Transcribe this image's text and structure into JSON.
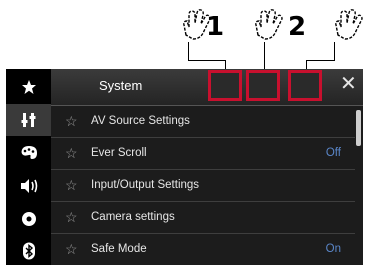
{
  "callouts": [
    {
      "number": "1"
    },
    {
      "number": "2"
    },
    {
      "number": ""
    }
  ],
  "header": {
    "title": "System"
  },
  "sidebar": {
    "items": [
      {
        "icon": "star-icon"
      },
      {
        "icon": "settings-icon"
      },
      {
        "icon": "theme-icon"
      },
      {
        "icon": "audio-icon"
      },
      {
        "icon": "disc-icon"
      },
      {
        "icon": "bluetooth-icon"
      }
    ]
  },
  "menu": {
    "items": [
      {
        "label": "AV Source Settings",
        "value": ""
      },
      {
        "label": "Ever Scroll",
        "value": "Off"
      },
      {
        "label": "Input/Output Settings",
        "value": ""
      },
      {
        "label": "Camera settings",
        "value": ""
      },
      {
        "label": "Safe Mode",
        "value": "On"
      }
    ]
  },
  "close_symbol": "✕",
  "colors": {
    "highlight": "#c8102e",
    "value_text": "#5a86c8",
    "active_sidebar": "#3a3a3a"
  }
}
